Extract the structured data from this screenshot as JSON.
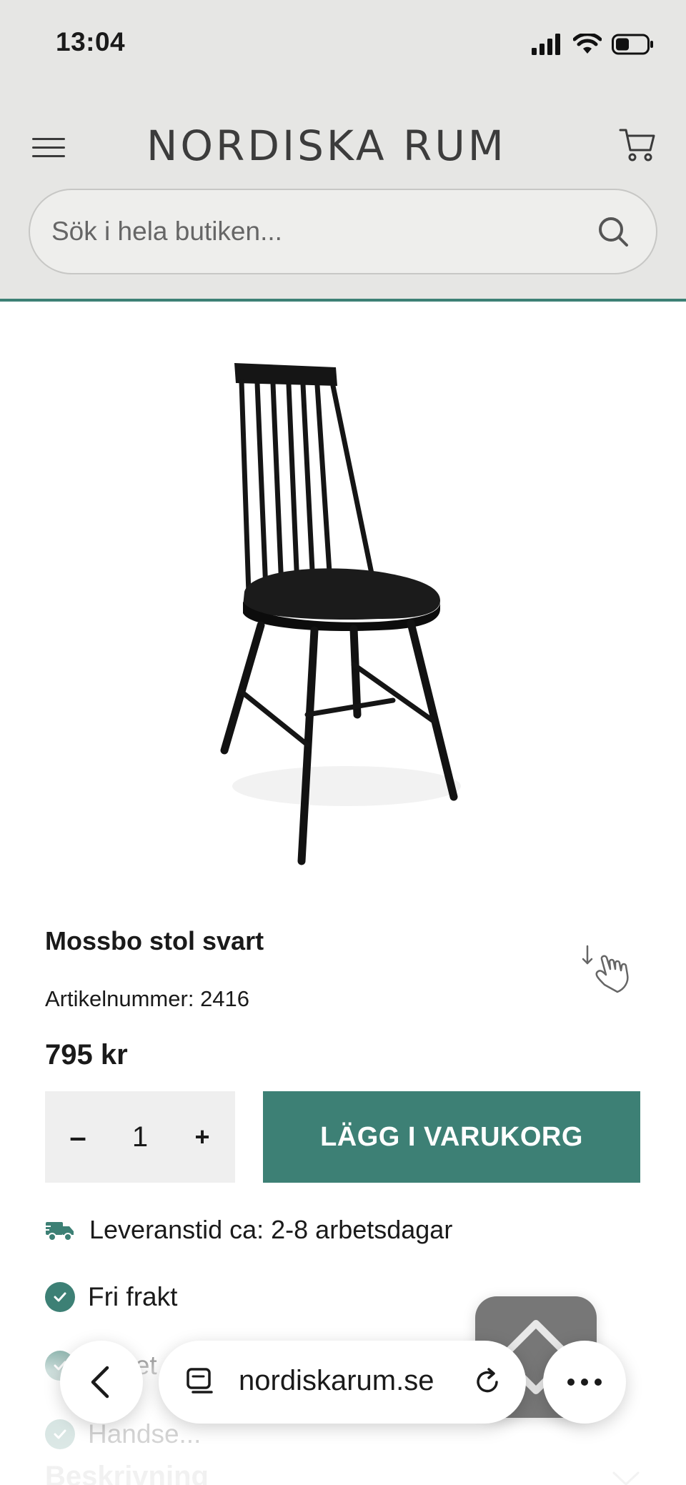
{
  "status_bar": {
    "time": "13:04"
  },
  "header": {
    "logo_text": "NORDISKA RUM",
    "search": {
      "placeholder": "Sök i hela butiken..."
    }
  },
  "product": {
    "title": "Mossbo stol svart",
    "article_label": "Artikelnummer:",
    "article_number": "2416",
    "price": "795 kr",
    "quantity": "1",
    "qty_minus_label": "–",
    "qty_plus_label": "+",
    "add_to_cart_label": "LÄGG I VARUKORG",
    "delivery_text": "Leveranstid ca: 2-8 arbetsdagar",
    "usps": [
      "Fri frakt",
      "Köpet ...",
      "Handse..."
    ],
    "description_heading": "Beskrivning"
  },
  "browser": {
    "url": "nordiskarum.se"
  },
  "colors": {
    "accent": "#3d8075",
    "header_bg": "#e6e6e4"
  },
  "icons": [
    "menu-icon",
    "cart-icon",
    "search-icon",
    "truck-icon",
    "check-icon",
    "scroll-hint-icon",
    "back-icon",
    "tabs-icon",
    "reload-icon",
    "more-icon"
  ]
}
